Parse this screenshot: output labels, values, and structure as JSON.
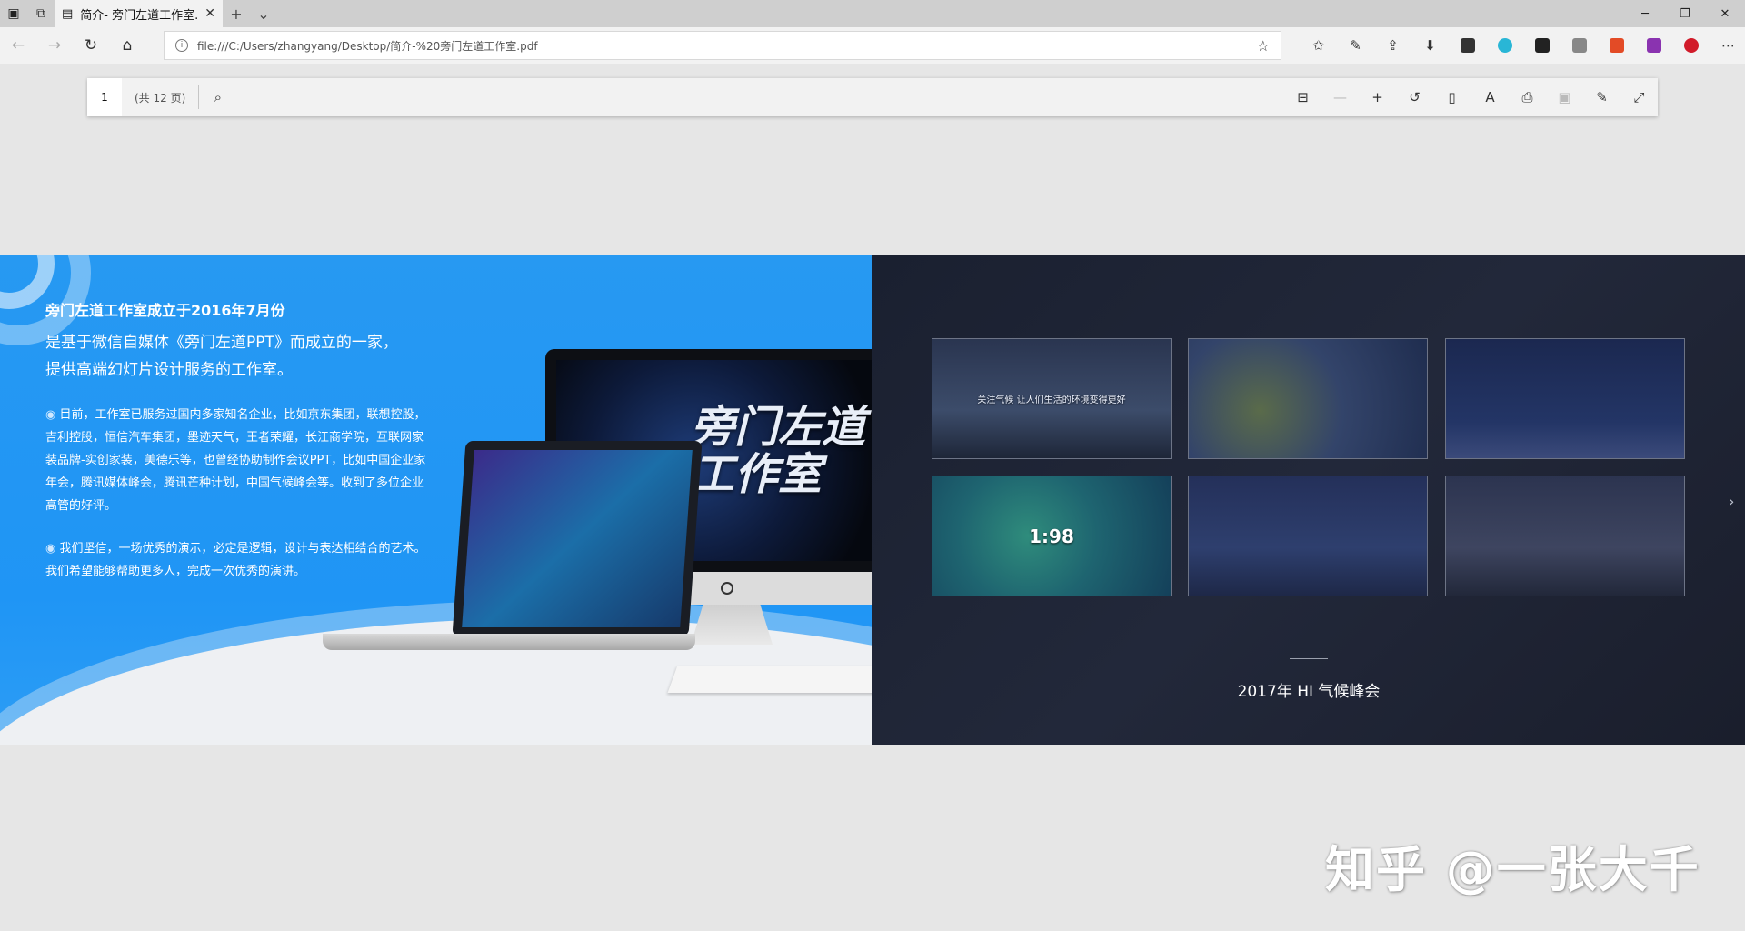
{
  "tab": {
    "title": "简介- 旁门左道工作室.p",
    "close": "✕",
    "new": "+",
    "menu": "⌄"
  },
  "window": {
    "minimize": "─",
    "maximize": "❐",
    "close": "✕"
  },
  "nav": {
    "back": "←",
    "forward": "→",
    "refresh": "↻",
    "home": "⌂"
  },
  "address": {
    "url": "file:///C:/Users/zhangyang/Desktop/简介-%20旁门左道工作室.pdf",
    "info": "i",
    "star": "☆"
  },
  "pdf_toolbar": {
    "page_number": "1",
    "page_total": "(共 12 页)",
    "search": "⌕"
  },
  "slide": {
    "left": {
      "title": "旁门左道工作室成立于2016年7月份",
      "subtitle_1": "是基于微信自媒体《旁门左道PPT》而成立的一家，",
      "subtitle_2": "提供高端幻灯片设计服务的工作室。",
      "bullet": "◉",
      "para_1": "目前，工作室已服务过国内多家知名企业，比如京东集团，联想控股，吉利控股，恒信汽车集团，墨迹天气，王者荣耀，长江商学院，互联网家装品牌-实创家装，美德乐等，也曾经协助制作会议PPT，比如中国企业家年会，腾讯媒体峰会，腾讯芒种计划，中国气候峰会等。收到了多位企业高管的好评。",
      "para_2": "我们坚信，一场优秀的演示，必定是逻辑，设计与表达相结合的艺术。我们希望能够帮助更多人，完成一次优秀的演讲。",
      "brand_line_1": "旁门左道",
      "brand_line_2": "工作室"
    },
    "right": {
      "thumbs": [
        {
          "label": "关注气候 让人们生活的环境变得更好",
          "bg": "linear-gradient(180deg,#2a3550,#3c4c6a 60%,#1e2638)"
        },
        {
          "label": "",
          "bg": "radial-gradient(circle at 30% 60%,#5a6b4a,#33446a 45%,#1f2d4f)"
        },
        {
          "label": "",
          "bg": "linear-gradient(180deg,#1b2850,#233566 70%,#3b4a7a)"
        },
        {
          "big": "1:98",
          "bg": "radial-gradient(circle at 40% 50%,#2f8c7c,#1e6470 45%,#14405a)"
        },
        {
          "label": "",
          "bg": "linear-gradient(180deg,#24305a,#2e3f6e 60%,#1e2848)"
        },
        {
          "label": "",
          "bg": "linear-gradient(180deg,#2c3450,#3e4560 60%,#22283a)"
        }
      ],
      "caption": "2017年 HI 气候峰会",
      "next": "›"
    }
  },
  "watermark": "知乎 @一张大千"
}
